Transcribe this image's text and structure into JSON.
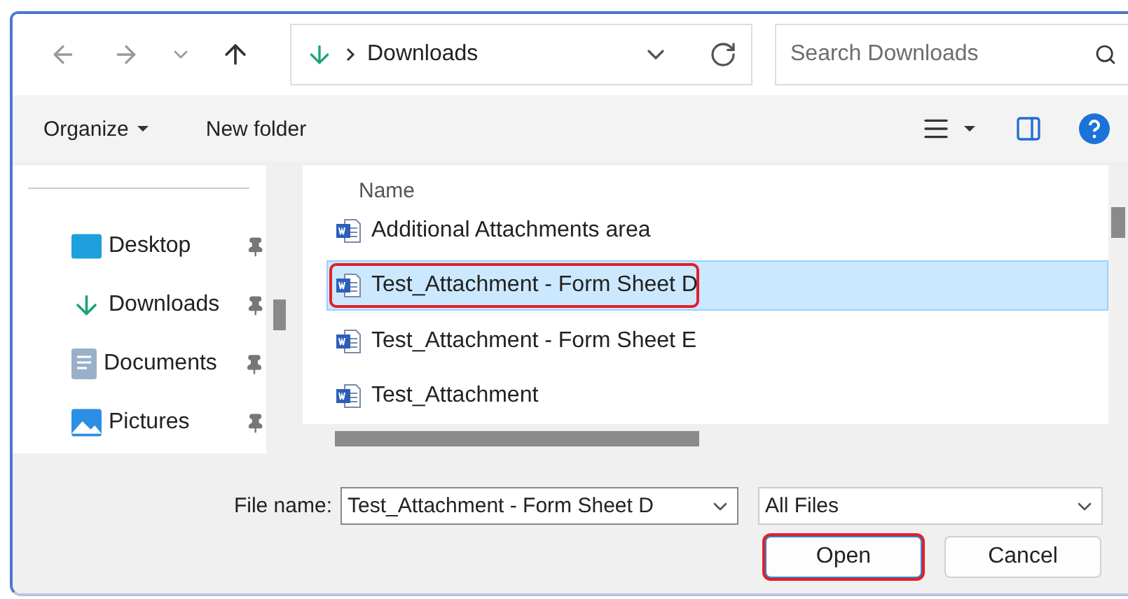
{
  "nav": {
    "location": "Downloads",
    "search_placeholder": "Search Downloads"
  },
  "toolbar": {
    "organize": "Organize",
    "new_folder": "New folder"
  },
  "sidebar": {
    "items": [
      {
        "label": "Desktop",
        "kind": "desktop",
        "pinned": true
      },
      {
        "label": "Downloads",
        "kind": "downloads",
        "pinned": true
      },
      {
        "label": "Documents",
        "kind": "documents",
        "pinned": true
      },
      {
        "label": "Pictures",
        "kind": "pictures",
        "pinned": true
      }
    ]
  },
  "files": {
    "column": "Name",
    "rows": [
      {
        "name": "Additional Attachments area",
        "selected": false,
        "highlighted": false
      },
      {
        "name": "Test_Attachment - Form Sheet D",
        "selected": true,
        "highlighted": true
      },
      {
        "name": "Test_Attachment - Form Sheet E",
        "selected": false,
        "highlighted": false
      },
      {
        "name": "Test_Attachment",
        "selected": false,
        "highlighted": false
      }
    ]
  },
  "footer": {
    "file_name_label": "File name:",
    "file_name": "Test_Attachment - Form Sheet D",
    "file_type": "All Files",
    "buttons": [
      {
        "label": "Open",
        "highlighted": true
      },
      {
        "label": "Cancel",
        "highlighted": false
      }
    ]
  }
}
